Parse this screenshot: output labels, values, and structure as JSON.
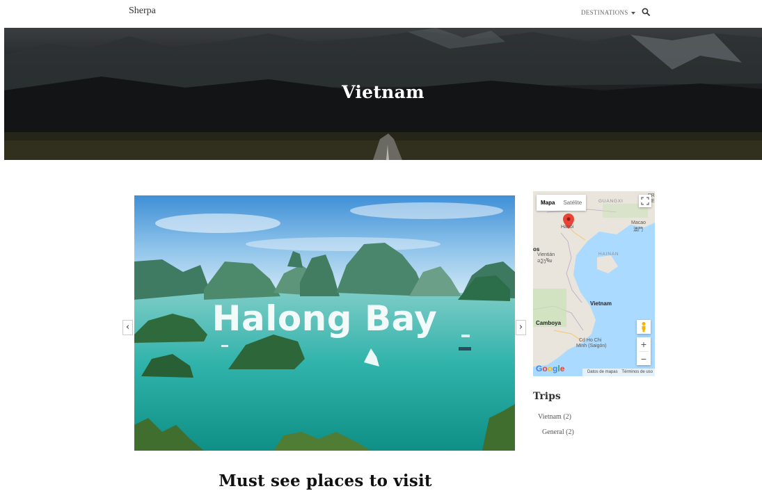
{
  "navbar": {
    "brand": "Sherpa",
    "destinations_label": "DESTINATIONS",
    "icons": {
      "caret": "caret-down-icon",
      "search": "search-icon"
    }
  },
  "hero": {
    "title": "Vietnam"
  },
  "carousel": {
    "caption": "Halong Bay",
    "prev_label": "‹",
    "next_label": "›"
  },
  "map": {
    "type_buttons": [
      "Mapa",
      "Satélite"
    ],
    "zoom_in": "+",
    "zoom_out": "−",
    "labels": {
      "guangxi": "GUANGXI",
      "hanoi": "Hanói",
      "macao": "Macao",
      "macao_local": "澳門",
      "laos": "os",
      "vientian": "Vientián",
      "vientian_local": "ວຽງຈັນ",
      "hainan": "HAINAN",
      "vietnam": "Vietnam",
      "camboya": "Camboya",
      "hcm": "Cd Ho Chi",
      "hcm2": "Minh (Saigón)",
      "edge_pr": "PR",
      "edge_de": "DE"
    },
    "google_logo": "Google",
    "footer": [
      "Datos de mapas",
      "Términos de uso"
    ],
    "colors": {
      "water": "#aadaff",
      "land": "#e9e5dc",
      "marker": "#ea4335"
    }
  },
  "sidebar": {
    "trips_title": "Trips",
    "trips": [
      {
        "label": "Vietnam (2)"
      },
      {
        "label": "General (2)"
      }
    ]
  },
  "content": {
    "section_title": "Must see places to visit"
  }
}
